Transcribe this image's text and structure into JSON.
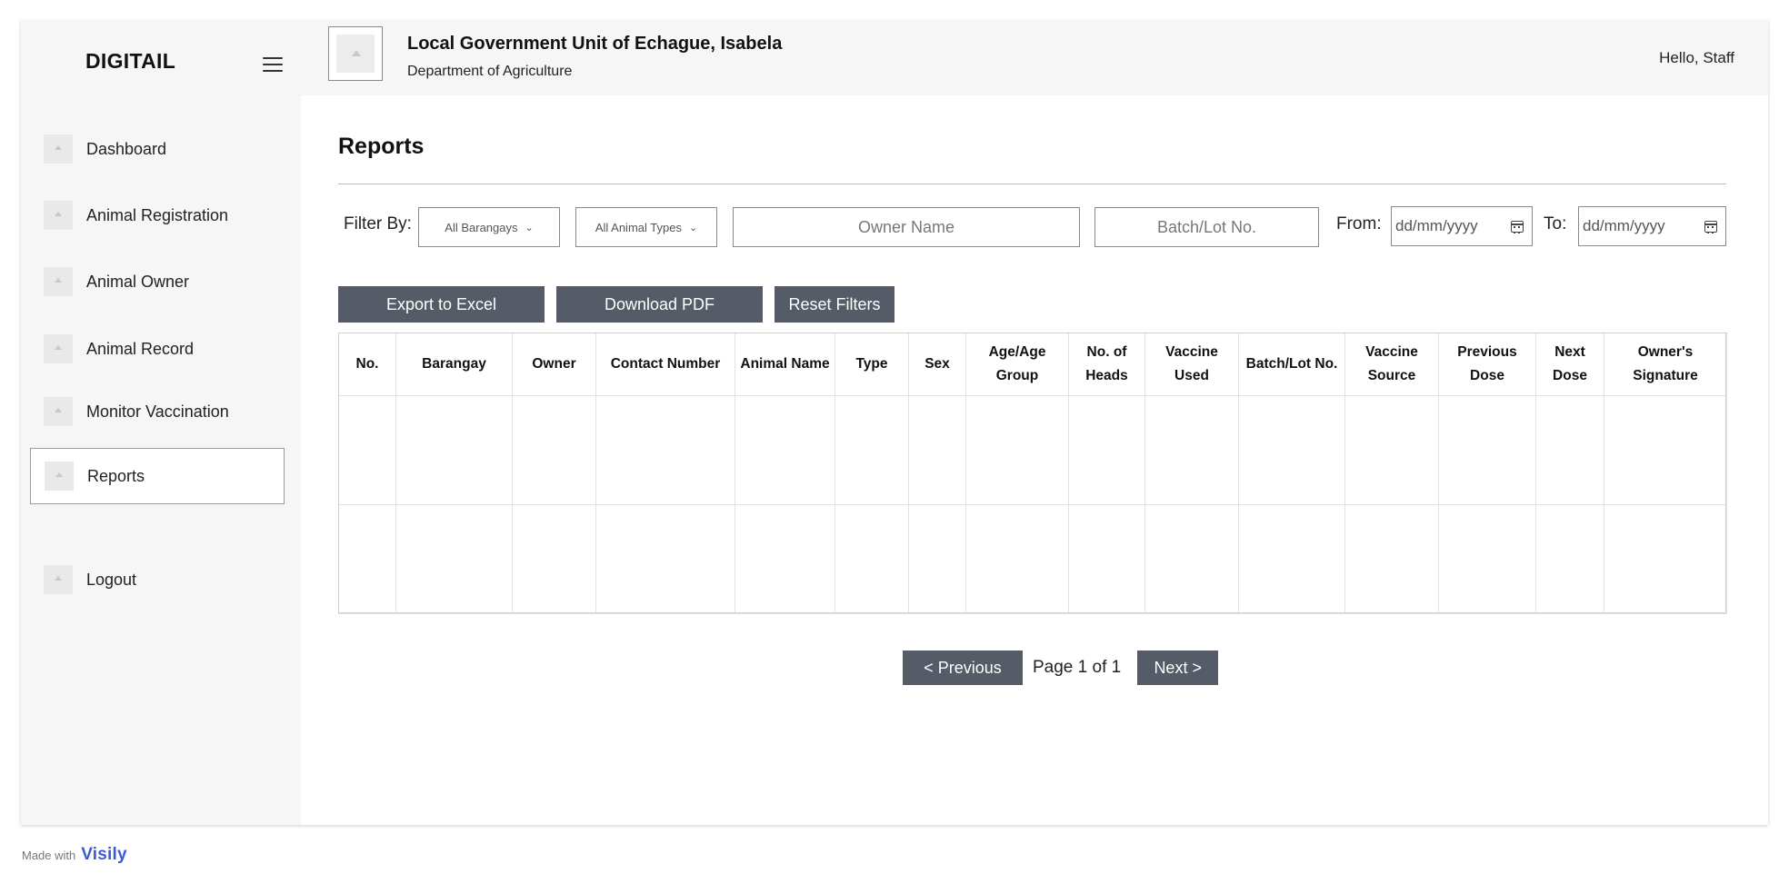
{
  "sidebar": {
    "brand": "DIGITAIL",
    "items": [
      {
        "label": "Dashboard",
        "active": false
      },
      {
        "label": "Animal Registration",
        "active": false
      },
      {
        "label": "Animal Owner",
        "active": false
      },
      {
        "label": "Animal Record",
        "active": false
      },
      {
        "label": "Monitor Vaccination",
        "active": false
      },
      {
        "label": "Reports",
        "active": true
      }
    ],
    "logout_label": "Logout"
  },
  "header": {
    "org_title": "Local Government Unit of Echague, Isabela",
    "org_subtitle": "Department of Agriculture",
    "greeting": "Hello, Staff"
  },
  "main": {
    "title": "Reports",
    "filters": {
      "label": "Filter By:",
      "barangay_select": "All Barangays",
      "animal_type_select": "All Animal Types",
      "owner_placeholder": "Owner Name",
      "batch_placeholder": "Batch/Lot No.",
      "from_label": "From:",
      "from_value": "dd/mm/yyyy",
      "to_label": "To:",
      "to_value": "dd/mm/yyyy"
    },
    "actions": {
      "export_excel": "Export to Excel",
      "download_pdf": "Download PDF",
      "reset_filters": "Reset Filters"
    },
    "table": {
      "columns": [
        "No.",
        "Barangay",
        "Owner",
        "Contact Number",
        "Animal Name",
        "Type",
        "Sex",
        "Age/Age Group",
        "No. of Heads",
        "Vaccine Used",
        "Batch/Lot No.",
        "Vaccine Source",
        "Previous Dose",
        "Next Dose",
        "Owner's Signature"
      ],
      "rows": [
        [
          "",
          "",
          "",
          "",
          "",
          "",
          "",
          "",
          "",
          "",
          "",
          "",
          "",
          "",
          ""
        ],
        [
          "",
          "",
          "",
          "",
          "",
          "",
          "",
          "",
          "",
          "",
          "",
          "",
          "",
          "",
          ""
        ]
      ]
    },
    "pagination": {
      "previous": "< Previous",
      "page_text": "Page 1 of 1",
      "next": "Next >"
    }
  },
  "footer": {
    "made_with": "Made with",
    "brand": "Visily"
  }
}
